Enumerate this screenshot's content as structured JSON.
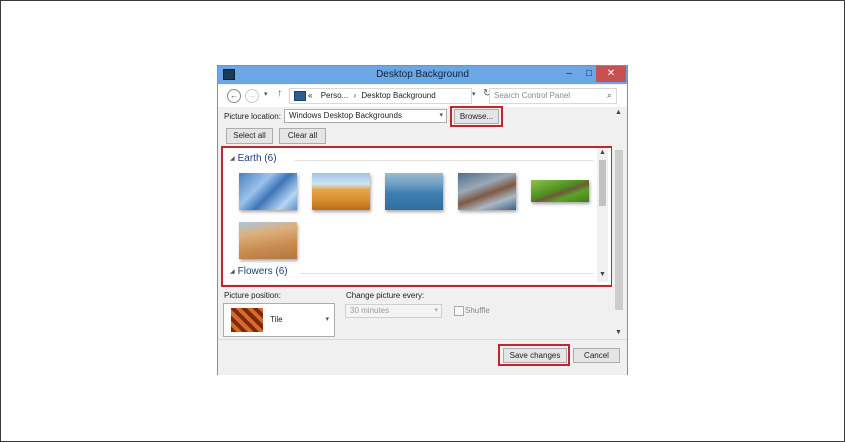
{
  "window": {
    "title": "Desktop Background",
    "min_glyph": "–",
    "max_glyph": "□",
    "close_glyph": "✕"
  },
  "nav": {
    "back_glyph": "←",
    "forward_glyph": "→",
    "recent_glyph": "▾",
    "up_glyph": "↑",
    "refresh_glyph": "↻"
  },
  "address": {
    "overflow": "«",
    "crumbs": [
      "Perso...",
      "Desktop Background"
    ],
    "separator": "›",
    "dropdown_glyph": "▾"
  },
  "search": {
    "placeholder": "Search Control Panel",
    "icon_glyph": "⌕"
  },
  "picture_location": {
    "label": "Picture location:",
    "value": "Windows Desktop Backgrounds",
    "dropdown_glyph": "▾",
    "browse_label": "Browse..."
  },
  "selection": {
    "select_all": "Select all",
    "clear_all": "Clear all"
  },
  "gallery": {
    "groups": [
      {
        "label": "Earth (6)",
        "expander": "◢"
      },
      {
        "label": "Flowers (6)",
        "expander": "◢"
      }
    ],
    "scroll_up": "▲",
    "scroll_down": "▼"
  },
  "picture_position": {
    "label": "Picture position:",
    "value": "Tile",
    "dropdown_glyph": "▾"
  },
  "change_picture": {
    "label": "Change picture every:",
    "value": "30 minutes",
    "dropdown_glyph": "▾",
    "shuffle_label": "Shuffle"
  },
  "main_scroll": {
    "up": "▲",
    "down": "▼"
  },
  "footer": {
    "save_label": "Save changes",
    "cancel_label": "Cancel"
  },
  "colors": {
    "titlebar": "#6aa7e4",
    "close": "#c75050",
    "highlight": "#c0272d",
    "group_header": "#1e3f7d"
  }
}
